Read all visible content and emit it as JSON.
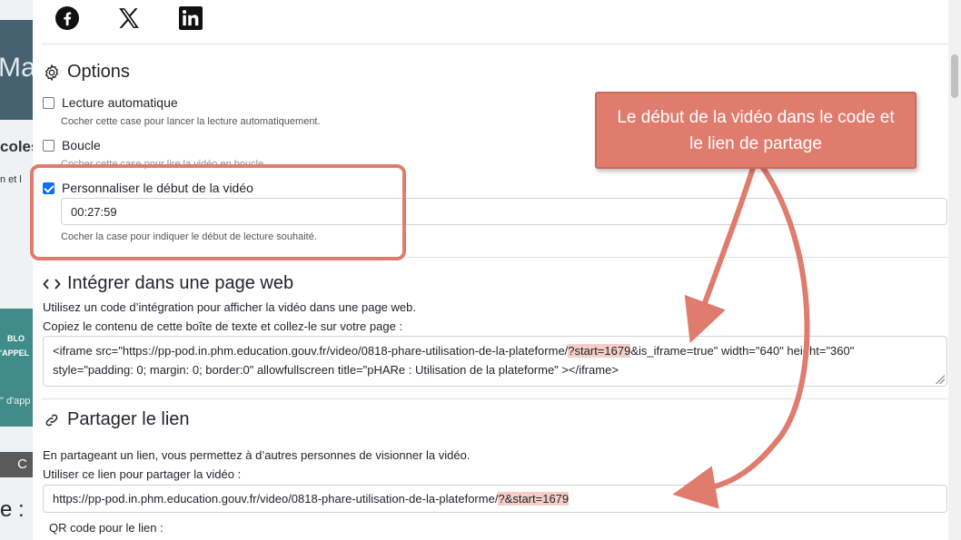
{
  "background": {
    "thumb_text": "Ma",
    "heading_fragment": "coles",
    "sub_fragment": "n et l",
    "card_line1": "BLO",
    "card_line2": "'APPEL",
    "card_line3": "\" d'app",
    "button_glyph": "C",
    "bottom_fragment": "e :"
  },
  "social": {
    "icons": [
      "facebook-icon",
      "x-icon",
      "linkedin-icon"
    ]
  },
  "options": {
    "title": "Options",
    "autoplay": {
      "label": "Lecture automatique",
      "checked": false,
      "help": "Cocher cette case pour lancer la lecture automatiquement."
    },
    "loop": {
      "label": "Boucle",
      "checked": false,
      "help": "Cocher cette case pour lire la vidéo en boucle."
    },
    "custom_start": {
      "label": "Personnaliser le début de la vidéo",
      "checked": true,
      "value": "00:27:59",
      "help": "Cocher la case pour indiquer le début de lecture souhaité."
    }
  },
  "embed": {
    "title": "Intégrer dans une page web",
    "desc1": "Utilisez un code d’intégration pour afficher la vidéo dans une page web.",
    "desc2": "Copiez le contenu de cette boîte de texte et collez-le sur votre page :",
    "code_before": "<iframe src=\"https://pp-pod.in.phm.education.gouv.fr/video/0818-phare-utilisation-de-la-plateforme/",
    "code_highlight": "?start=1679",
    "code_after": "&is_iframe=true\" width=\"640\" height=\"360\" style=\"padding: 0; margin: 0; border:0\" allowfullscreen title=\"pHARe : Utilisation de la plateforme\" ></iframe>"
  },
  "share": {
    "title": "Partager le lien",
    "desc1": "En partageant un lien, vous permettez à d’autres personnes de visionner la vidéo.",
    "desc2": "Utiliser ce lien pour partager la vidéo :",
    "link_before": "https://pp-pod.in.phm.education.gouv.fr/video/0818-phare-utilisation-de-la-plateforme/",
    "link_highlight": "?&start=1679",
    "qr_label": "QR code pour le lien :"
  },
  "annotation": {
    "callout_text": "Le début de la vidéo dans le code et le lien de partage",
    "color": "#e07c6d"
  }
}
